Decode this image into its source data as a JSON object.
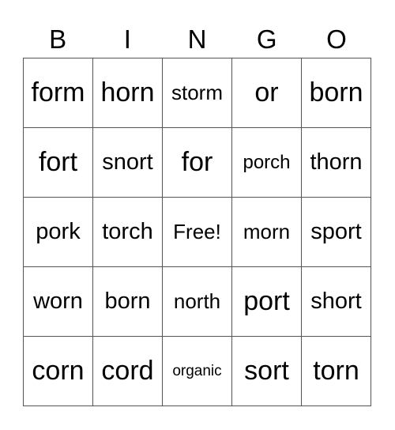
{
  "header": [
    "B",
    "I",
    "N",
    "G",
    "O"
  ],
  "grid": [
    [
      "form",
      "horn",
      "storm",
      "or",
      "born"
    ],
    [
      "fort",
      "snort",
      "for",
      "porch",
      "thorn"
    ],
    [
      "pork",
      "torch",
      "Free!",
      "morn",
      "sport"
    ],
    [
      "worn",
      "born",
      "north",
      "port",
      "short"
    ],
    [
      "corn",
      "cord",
      "organic",
      "sort",
      "torn"
    ]
  ]
}
